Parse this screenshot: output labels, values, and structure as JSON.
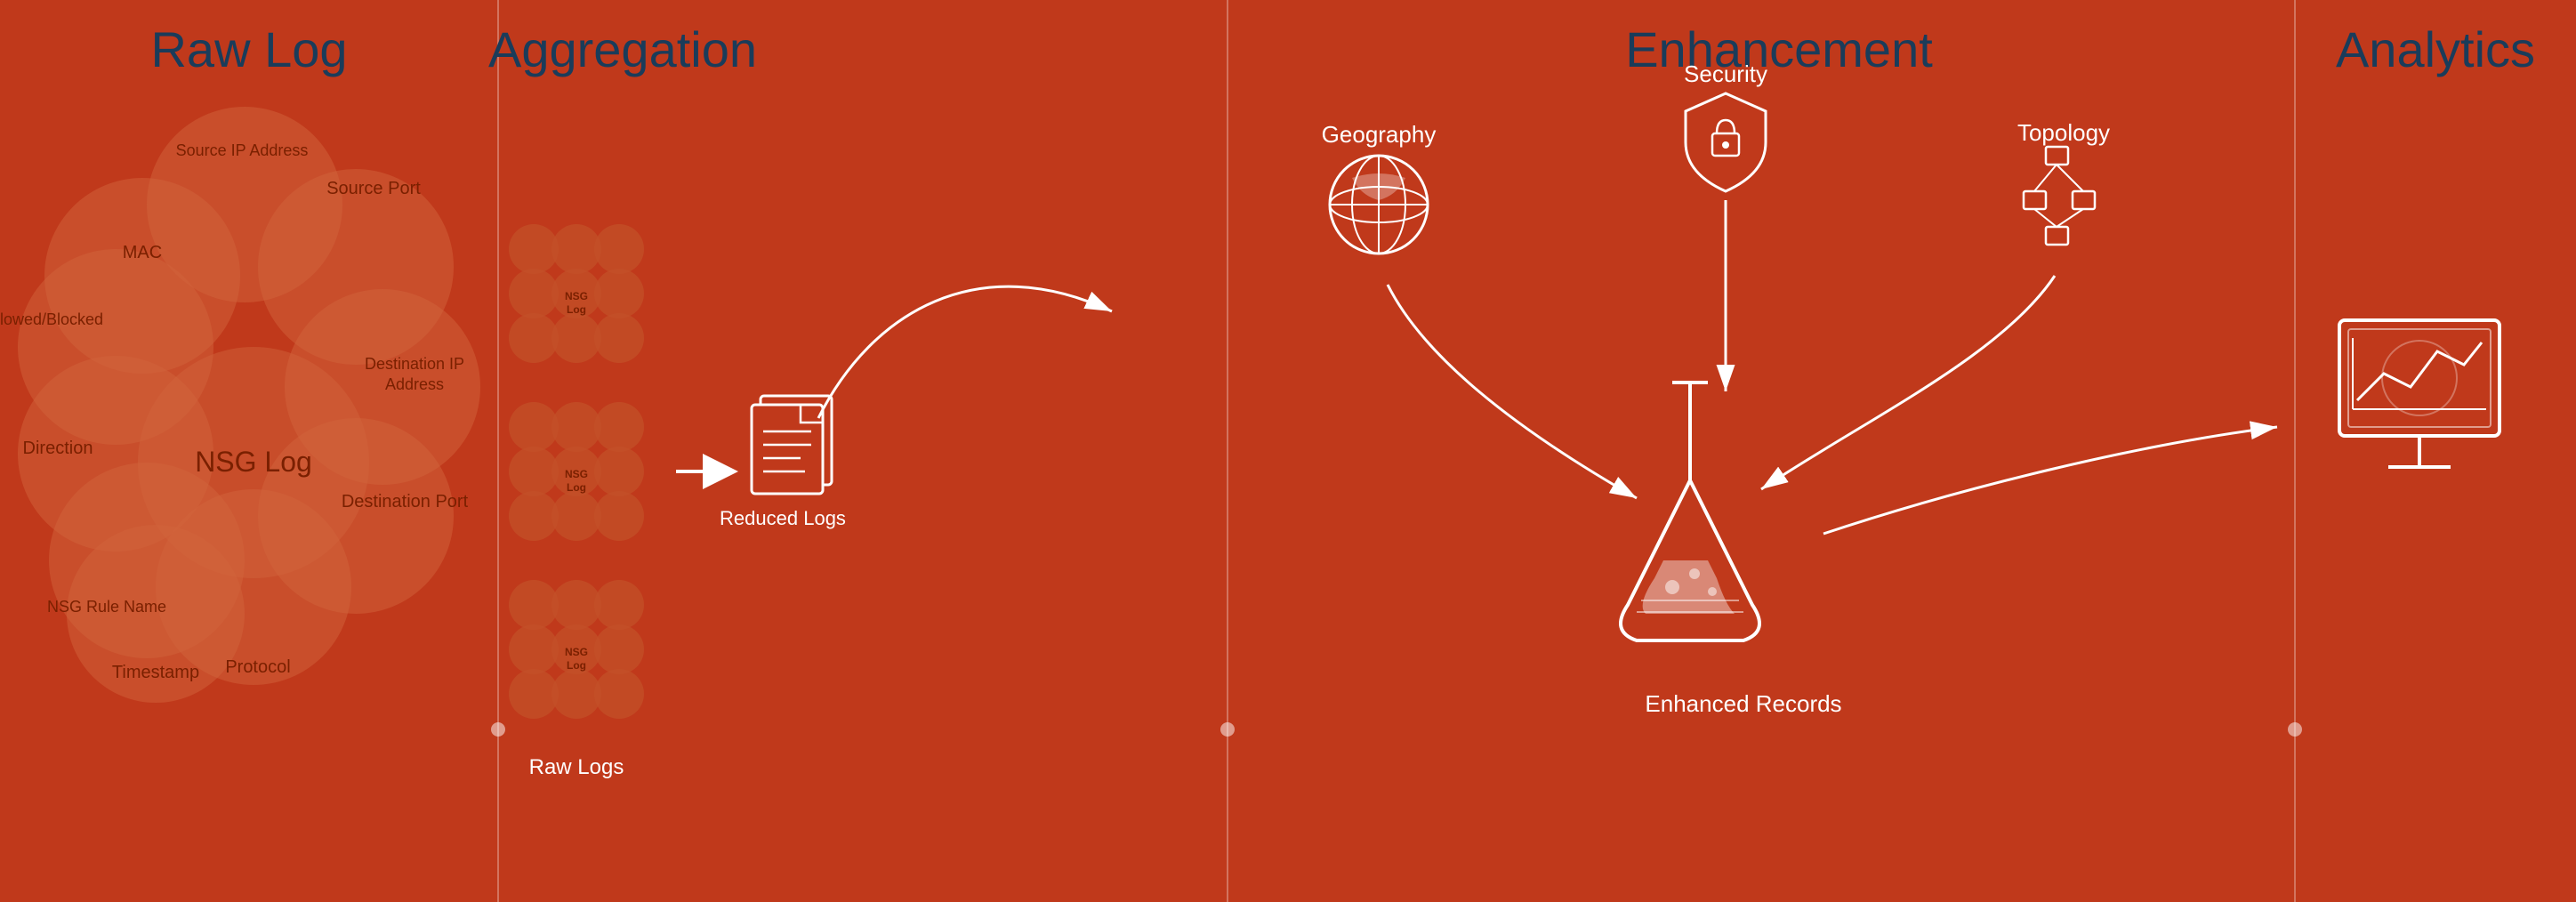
{
  "leftPanel": {
    "title": "Raw Log",
    "centerLabel": "NSG Log",
    "labels": {
      "mac": "MAC",
      "sourceIP": "Source IP Address",
      "sourcePort": "Source Port",
      "destIP": "Destination IP\nAddress",
      "destPort": "Destination Port",
      "protocol": "Protocol",
      "timestamp": "Timestamp",
      "direction": "Direction",
      "allowed": "Allowed/Blocked",
      "nsgRule": "NSG Rule Name"
    }
  },
  "aggregation": {
    "title": "Aggregation",
    "stackLabel": "NSG\nLog",
    "rawLogsLabel": "Raw Logs",
    "reducedLogsLabel": "Reduced Logs"
  },
  "enhancement": {
    "title": "Enhancement",
    "geography": "Geography",
    "security": "Security",
    "topology": "Topology",
    "enhancedRecords": "Enhanced Records"
  },
  "analytics": {
    "title": "Analytics"
  },
  "colors": {
    "background": "#c0391b",
    "titleColor": "#1a5276",
    "circleColor": "rgba(210,100,60,0.55)",
    "white": "#ffffff"
  }
}
